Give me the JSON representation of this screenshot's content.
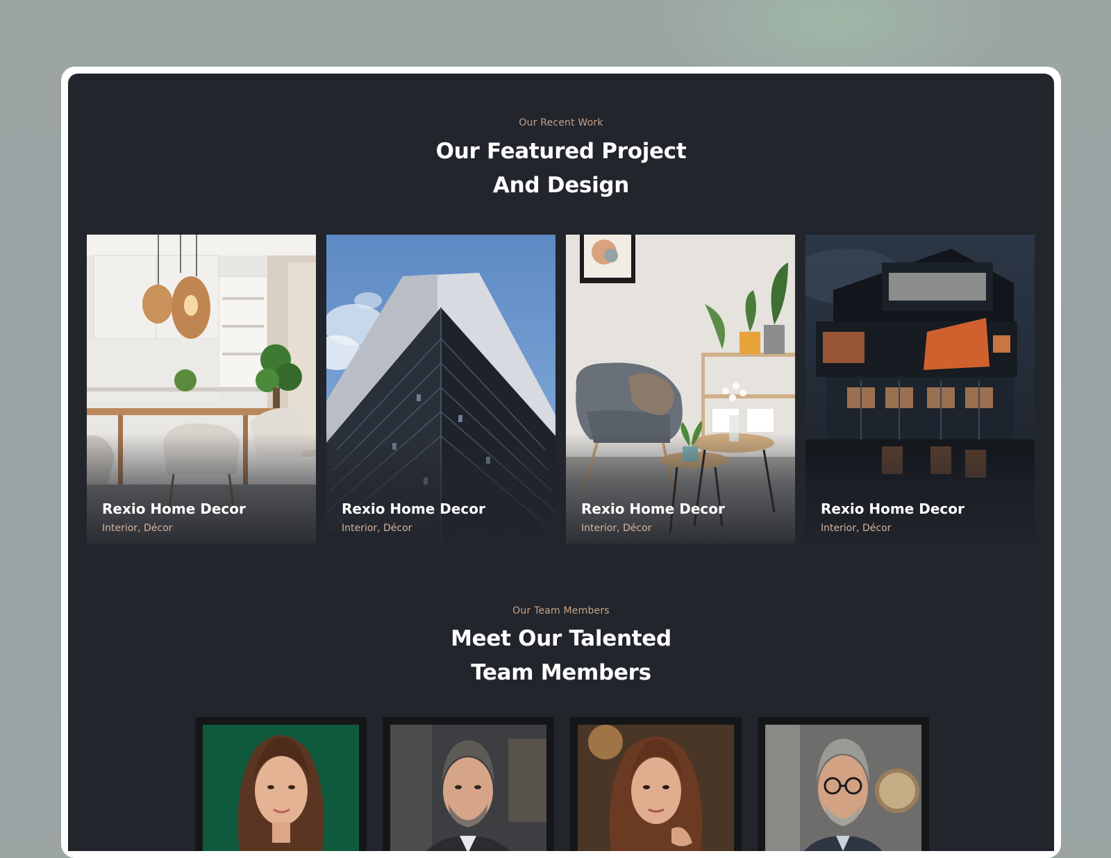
{
  "projects_section": {
    "eyebrow": "Our Recent Work",
    "heading_line1": "Our Featured Project",
    "heading_line2": "And Design",
    "cards": [
      {
        "title": "Rexio Home Decor",
        "tags": "Interior, Décor"
      },
      {
        "title": "Rexio Home Decor",
        "tags": "Interior, Décor"
      },
      {
        "title": "Rexio Home Decor",
        "tags": "Interior, Décor"
      },
      {
        "title": "Rexio Home Decor",
        "tags": "Interior, Décor"
      }
    ]
  },
  "team_section": {
    "eyebrow": "Our Team Members",
    "heading_line1": "Meet Our Talented",
    "heading_line2": "Team Members"
  },
  "colors": {
    "panel_background": "#22252c",
    "accent": "#c9a187",
    "heading": "#ffffff"
  }
}
